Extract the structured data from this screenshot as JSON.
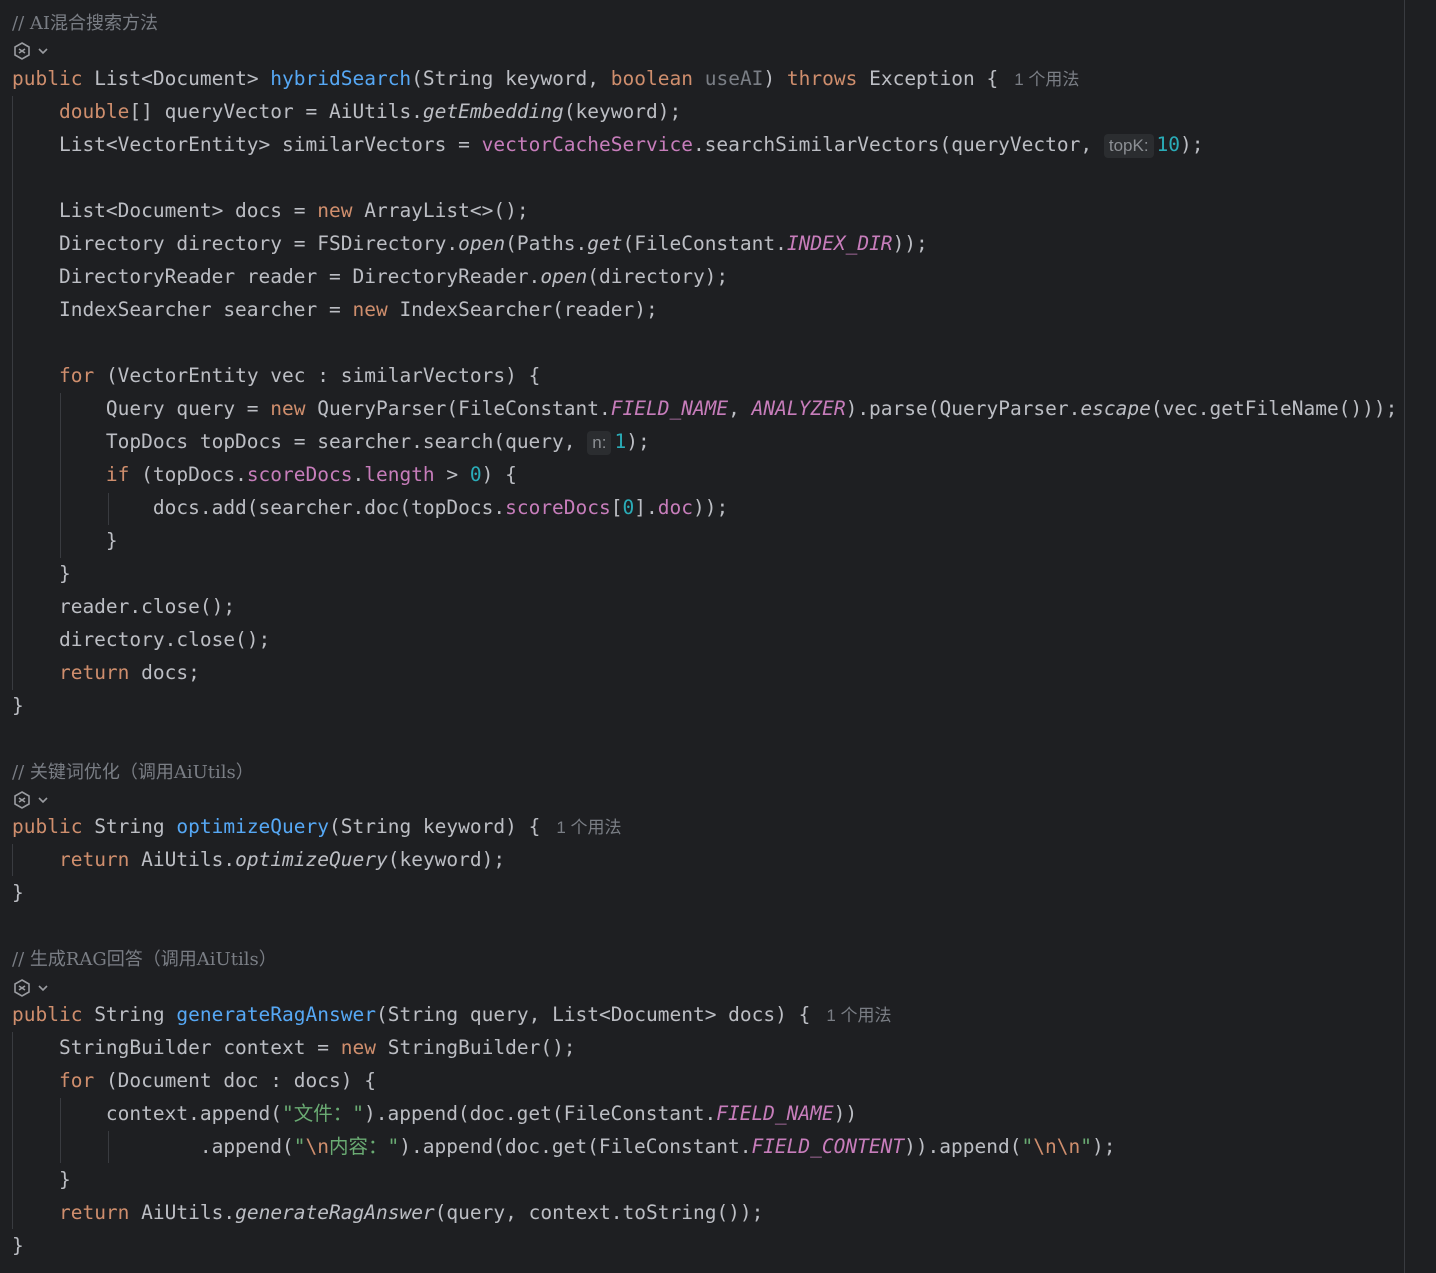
{
  "editor": {
    "comments": {
      "hybrid": "// AI混合搜索方法",
      "optimize": "// 关键词优化（调用AiUtils）",
      "rag": "// 生成RAG回答（调用AiUtils）"
    },
    "usages": {
      "hybrid": "1 个用法",
      "optimize": "1 个用法",
      "rag": "1 个用法"
    },
    "hints": {
      "topk_name": "topK:",
      "topk_value": "10",
      "n_name": "n:",
      "n_value": "1"
    },
    "gutter_icon": "ai-assistant-icon"
  }
}
